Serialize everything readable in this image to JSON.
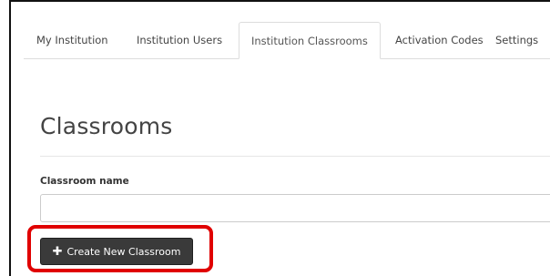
{
  "tabs": [
    {
      "label": "My Institution"
    },
    {
      "label": "Institution Users"
    },
    {
      "label": "Institution Classrooms",
      "active": true
    },
    {
      "label": "Activation Codes"
    },
    {
      "label": "Settings"
    }
  ],
  "main": {
    "title": "Classrooms",
    "field_label": "Classroom name",
    "input_value": "",
    "input_placeholder": "",
    "create_button_label": "Create New Classroom",
    "create_button_icon": "plus-icon"
  },
  "colors": {
    "highlight": "#e00000",
    "button_bg": "#3a3a3a"
  }
}
